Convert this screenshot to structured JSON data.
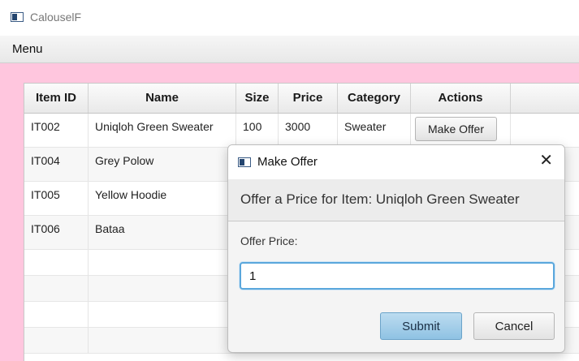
{
  "window": {
    "title": "CalouselF"
  },
  "menubar": {
    "menu_label": "Menu"
  },
  "table": {
    "columns": [
      "Item ID",
      "Name",
      "Size",
      "Price",
      "Category",
      "Actions"
    ],
    "rows": [
      {
        "id": "IT002",
        "name": "Uniqloh Green Sweater",
        "size": "100",
        "price": "3000",
        "category": "Sweater",
        "action": "Make Offer"
      },
      {
        "id": "IT004",
        "name": "Grey Polow",
        "size": "",
        "price": "",
        "category": "",
        "action": ""
      },
      {
        "id": "IT005",
        "name": "Yellow Hoodie",
        "size": "",
        "price": "",
        "category": "",
        "action": ""
      },
      {
        "id": "IT006",
        "name": "Bataa",
        "size": "",
        "price": "",
        "category": "",
        "action": ""
      }
    ]
  },
  "dialog": {
    "title": "Make Offer",
    "close_symbol": "✕",
    "header_text": "Offer a Price for Item: Uniqloh Green Sweater",
    "field_label": "Offer Price:",
    "field_value": "1",
    "submit_label": "Submit",
    "cancel_label": "Cancel"
  }
}
